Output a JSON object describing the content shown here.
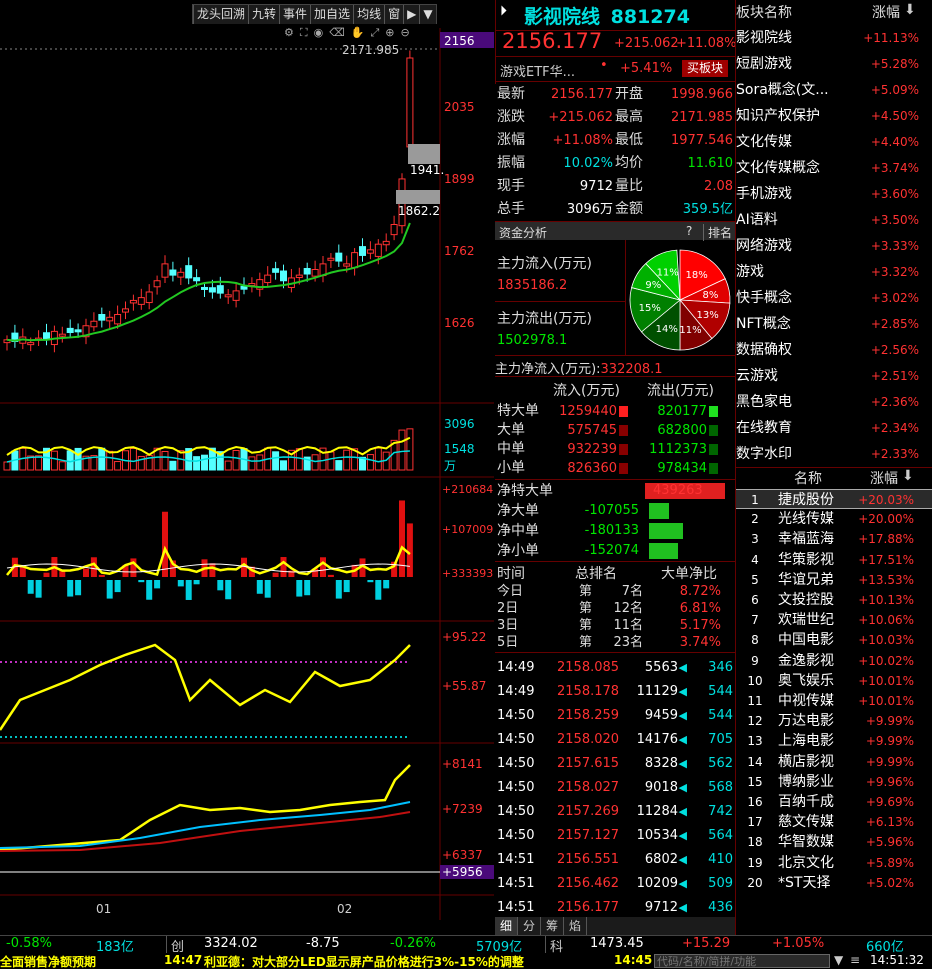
{
  "toolbar": {
    "items": [
      "龙头回溯",
      "九转",
      "事件",
      "加自选",
      "均线",
      "窗"
    ]
  },
  "chart": {
    "y_labels": [
      "2156",
      "2035",
      "1899",
      "1762",
      "1626"
    ],
    "high_label": "2171.985",
    "mid_label": "1941.",
    "low_label": "1862.2",
    "vol_labels": [
      "3096",
      "1548",
      "万"
    ],
    "flow_labels": [
      "+210684",
      "+107009",
      "+333393"
    ],
    "kdj_labels": [
      "+95.22",
      "+55.87"
    ],
    "obv_labels": [
      "+8141",
      "+7239",
      "+6337",
      "+5956"
    ],
    "x_labels": [
      "01",
      "02"
    ]
  },
  "header": {
    "name": "影视院线",
    "code": "881274",
    "price": "2156.177",
    "change": "+215.062",
    "pct": "+11.08%",
    "etf_name": "游戏ETF华...",
    "etf_dot": "•",
    "etf_pct": "+5.41%",
    "buy_button": "买板块"
  },
  "quote": [
    {
      "l1": "最新",
      "v1": "2156.177",
      "l2": "开盘",
      "v2": "1998.966",
      "c1": "red",
      "c2": "red"
    },
    {
      "l1": "涨跌",
      "v1": "+215.062",
      "l2": "最高",
      "v2": "2171.985",
      "c1": "red",
      "c2": "red"
    },
    {
      "l1": "涨幅",
      "v1": "+11.08%",
      "l2": "最低",
      "v2": "1977.546",
      "c1": "red",
      "c2": "red"
    },
    {
      "l1": "振幅",
      "v1": "10.02%",
      "l2": "均价",
      "v2": "11.610",
      "c1": "cyn",
      "c2": "grn"
    },
    {
      "l1": "现手",
      "v1": "9712",
      "l2": "量比",
      "v2": "2.08",
      "c1": "wht",
      "c2": "red"
    },
    {
      "l1": "总手",
      "v1": "3096万",
      "l2": "金额",
      "v2": "359.5亿",
      "c1": "wht",
      "c2": "cyn"
    }
  ],
  "fund": {
    "title": "资金分析",
    "help": "?",
    "rank": "排名",
    "in_label": "主力流入(万元)",
    "in_value": "1835186.2",
    "out_label": "主力流出(万元)",
    "out_value": "1502978.1",
    "net_label": "主力净流入(万元):",
    "net_value": "332208.1",
    "pie": [
      {
        "label": "18%",
        "frac": 0.18,
        "color": "#ff0000"
      },
      {
        "label": "8%",
        "frac": 0.08,
        "color": "#e00000"
      },
      {
        "label": "13%",
        "frac": 0.13,
        "color": "#b00000"
      },
      {
        "label": "11%",
        "frac": 0.11,
        "color": "#800000"
      },
      {
        "label": "14%",
        "frac": 0.14,
        "color": "#005000"
      },
      {
        "label": "15%",
        "frac": 0.15,
        "color": "#008000"
      },
      {
        "label": "9%",
        "frac": 0.09,
        "color": "#00b000"
      },
      {
        "label": "11%",
        "frac": 0.11,
        "color": "#00d000"
      }
    ]
  },
  "flow_table": {
    "h_in": "流入(万元)",
    "h_out": "流出(万元)",
    "rows": [
      {
        "name": "特大单",
        "in": "1259440",
        "out": "820177"
      },
      {
        "name": "大单",
        "in": "575745",
        "out": "682800"
      },
      {
        "name": "中单",
        "in": "932239",
        "out": "1112373"
      },
      {
        "name": "小单",
        "in": "826360",
        "out": "978434"
      }
    ]
  },
  "net": {
    "rows": [
      {
        "name": "净特大单",
        "value": "439263",
        "sign": 1,
        "frac": 0.8
      },
      {
        "name": "净大单",
        "value": "-107055",
        "sign": -1,
        "frac": 0.2
      },
      {
        "name": "净中单",
        "value": "-180133",
        "sign": -1,
        "frac": 0.34
      },
      {
        "name": "净小单",
        "value": "-152074",
        "sign": -1,
        "frac": 0.29
      }
    ]
  },
  "rank": {
    "h1": "时间",
    "h2": "总排名",
    "h3": "大单净比",
    "rows": [
      {
        "d": "今日",
        "pre": "第",
        "n": "7名",
        "r": "8.72%"
      },
      {
        "d": "2日",
        "pre": "第",
        "n": "12名",
        "r": "6.81%"
      },
      {
        "d": "3日",
        "pre": "第",
        "n": "11名",
        "r": "5.17%"
      },
      {
        "d": "5日",
        "pre": "第",
        "n": "23名",
        "r": "3.74%"
      }
    ]
  },
  "ticks": [
    {
      "t": "14:49",
      "p": "2158.085",
      "v": "5563",
      "c": "346"
    },
    {
      "t": "14:49",
      "p": "2158.178",
      "v": "11129",
      "c": "544"
    },
    {
      "t": "14:50",
      "p": "2158.259",
      "v": "9459",
      "c": "544"
    },
    {
      "t": "14:50",
      "p": "2158.020",
      "v": "14176",
      "c": "705"
    },
    {
      "t": "14:50",
      "p": "2157.615",
      "v": "8328",
      "c": "562"
    },
    {
      "t": "14:50",
      "p": "2158.027",
      "v": "9018",
      "c": "568"
    },
    {
      "t": "14:50",
      "p": "2157.269",
      "v": "11284",
      "c": "742"
    },
    {
      "t": "14:50",
      "p": "2157.127",
      "v": "10534",
      "c": "564"
    },
    {
      "t": "14:51",
      "p": "2156.551",
      "v": "6802",
      "c": "410"
    },
    {
      "t": "14:51",
      "p": "2156.462",
      "v": "10209",
      "c": "509"
    },
    {
      "t": "14:51",
      "p": "2156.177",
      "v": "9712",
      "c": "436"
    }
  ],
  "tick_tabs": [
    "细",
    "分",
    "筹",
    "焰"
  ],
  "sectors": {
    "h_name": "板块名称",
    "h_pct": "涨幅",
    "rows": [
      {
        "n": "影视院线",
        "p": "+11.13%"
      },
      {
        "n": "短剧游戏",
        "p": "+5.28%"
      },
      {
        "n": "Sora概念(文...",
        "p": "+5.09%"
      },
      {
        "n": "知识产权保护",
        "p": "+4.50%"
      },
      {
        "n": "文化传媒",
        "p": "+4.40%"
      },
      {
        "n": "文化传媒概念",
        "p": "+3.74%"
      },
      {
        "n": "手机游戏",
        "p": "+3.60%"
      },
      {
        "n": "AI语料",
        "p": "+3.50%"
      },
      {
        "n": "网络游戏",
        "p": "+3.33%"
      },
      {
        "n": "游戏",
        "p": "+3.32%"
      },
      {
        "n": "快手概念",
        "p": "+3.02%"
      },
      {
        "n": "NFT概念",
        "p": "+2.85%"
      },
      {
        "n": "数据确权",
        "p": "+2.56%"
      },
      {
        "n": "云游戏",
        "p": "+2.51%"
      },
      {
        "n": "黑色家电",
        "p": "+2.36%"
      },
      {
        "n": "在线教育",
        "p": "+2.34%"
      },
      {
        "n": "数字水印",
        "p": "+2.33%"
      }
    ]
  },
  "stocks": {
    "h_name": "名称",
    "h_pct": "涨幅",
    "rows": [
      {
        "i": "1",
        "n": "捷成股份",
        "p": "+20.03%"
      },
      {
        "i": "2",
        "n": "光线传媒",
        "p": "+20.00%"
      },
      {
        "i": "3",
        "n": "幸福蓝海",
        "p": "+17.88%"
      },
      {
        "i": "4",
        "n": "华策影视",
        "p": "+17.51%"
      },
      {
        "i": "5",
        "n": "华谊兄弟",
        "p": "+13.53%"
      },
      {
        "i": "6",
        "n": "文投控股",
        "p": "+10.13%"
      },
      {
        "i": "7",
        "n": "欢瑞世纪",
        "p": "+10.06%"
      },
      {
        "i": "8",
        "n": "中国电影",
        "p": "+10.03%"
      },
      {
        "i": "9",
        "n": "金逸影视",
        "p": "+10.02%"
      },
      {
        "i": "10",
        "n": "奥飞娱乐",
        "p": "+10.01%"
      },
      {
        "i": "11",
        "n": "中视传媒",
        "p": "+10.01%"
      },
      {
        "i": "12",
        "n": "万达电影",
        "p": "+9.99%"
      },
      {
        "i": "13",
        "n": "上海电影",
        "p": "+9.99%"
      },
      {
        "i": "14",
        "n": "横店影视",
        "p": "+9.99%"
      },
      {
        "i": "15",
        "n": "博纳影业",
        "p": "+9.96%"
      },
      {
        "i": "16",
        "n": "百纳千成",
        "p": "+9.69%"
      },
      {
        "i": "17",
        "n": "慈文传媒",
        "p": "+6.13%"
      },
      {
        "i": "18",
        "n": "华智数媒",
        "p": "+5.96%"
      },
      {
        "i": "19",
        "n": "北京文化",
        "p": "+5.89%"
      },
      {
        "i": "20",
        "n": "*ST天择",
        "p": "+5.02%"
      }
    ]
  },
  "status": {
    "s1": "-0.58%",
    "s2": "183亿",
    "s3": "创",
    "s4": "3324.02",
    "s5": "-8.75",
    "s6": "-0.26%",
    "s7": "5709亿",
    "s8": "科",
    "s9": "1473.45",
    "s10": "+15.29",
    "s11": "+1.05%",
    "s12": "660亿"
  },
  "news": {
    "left": "全面销售净额预期",
    "time": "14:47",
    "text": "利亚德：对大部分LED显示屏产品价格进行3%-15%的调整",
    "time2": "14:45",
    "search_placeholder": "代码/名称/简拼/功能",
    "clock": "14:51:32"
  }
}
